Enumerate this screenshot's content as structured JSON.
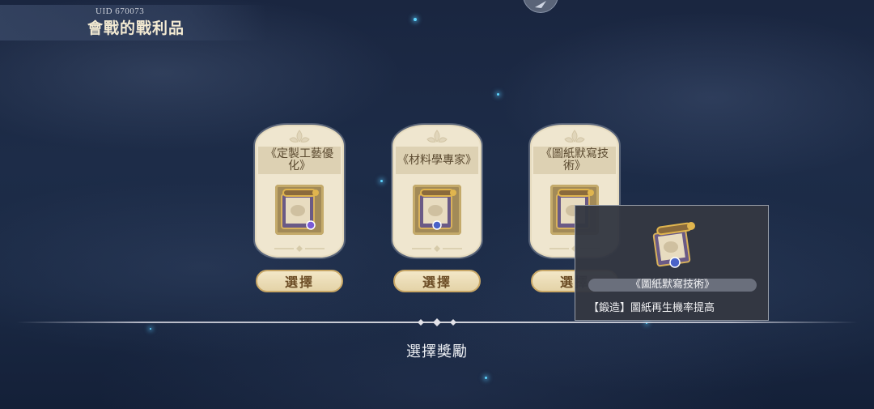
{
  "header": {
    "uid": "UID 670073",
    "title": "會戰的戰利品"
  },
  "cards": [
    {
      "name": "《定製工藝優化》",
      "select_label": "選擇",
      "badge_color": "#7a5bd6"
    },
    {
      "name": "《材料學專家》",
      "select_label": "選擇",
      "badge_color": "#4a63c8"
    },
    {
      "name": "《圖紙默寫技術》",
      "select_label": "選擇",
      "badge_color": "#4a63c8"
    }
  ],
  "tooltip": {
    "name": "《圖紙默寫技術》",
    "description": "【鍛造】圖紙再生機率提高"
  },
  "footer": {
    "label": "選擇獎勵"
  },
  "colors": {
    "card_bg": "#efe6cf",
    "button_bg": "#f3e7c7",
    "tooltip_bg": "#343842"
  }
}
